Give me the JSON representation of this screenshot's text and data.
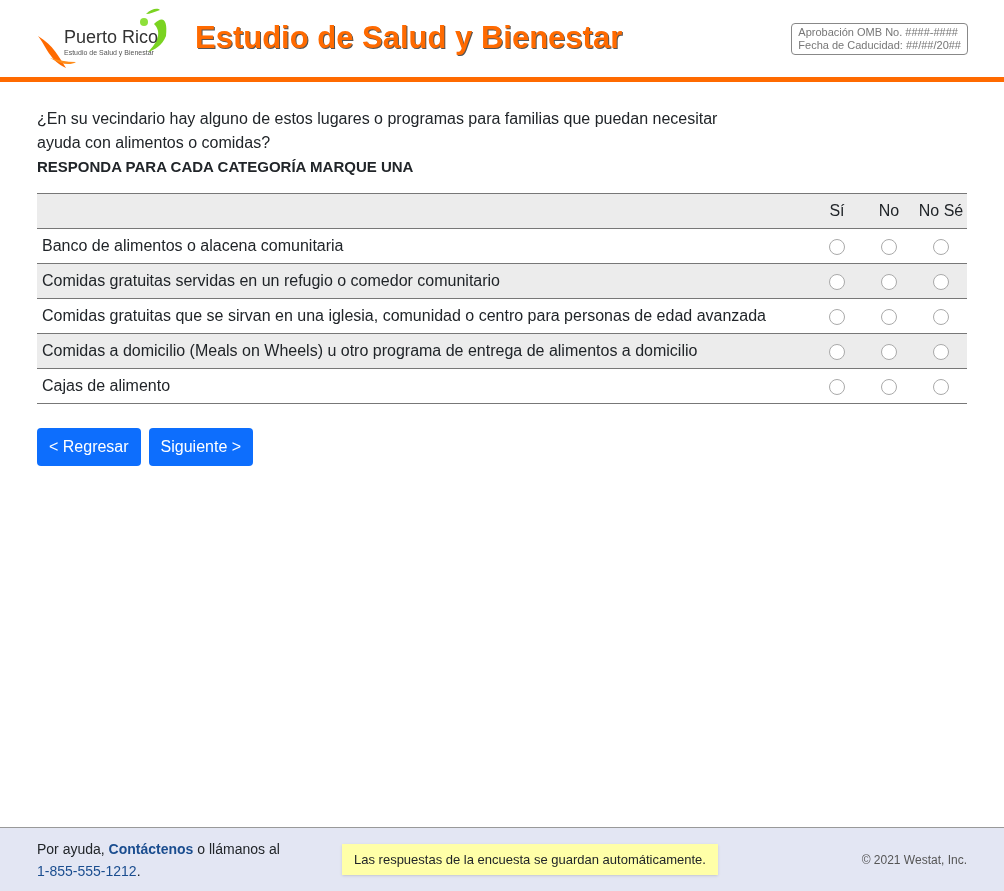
{
  "header": {
    "logo_name": "Puerto Rico",
    "logo_tagline": "Estudio de Salud y Bienestar",
    "title": "Estudio de Salud y Bienestar",
    "omb_lines": [
      "Aprobación OMB No. ####-####",
      "Fecha de Caducidad: ##/##/20##"
    ]
  },
  "question": {
    "text": "¿En su vecindario hay alguno de estos lugares o programas para familias que puedan necesitar ayuda con alimentos o comidas?",
    "instruction": "RESPONDA PARA CADA CATEGORÍA MARQUE UNA"
  },
  "table": {
    "columns": [
      "Sí",
      "No",
      "No Sé"
    ],
    "rows": [
      {
        "label": "Banco de alimentos o alacena comunitaria",
        "options": [
          {
            "selected": false
          },
          {
            "selected": false
          },
          {
            "selected": false
          }
        ]
      },
      {
        "label": "Comidas gratuitas servidas en un refugio o comedor comunitario",
        "options": [
          {
            "selected": false
          },
          {
            "selected": false
          },
          {
            "selected": false
          }
        ]
      },
      {
        "label": "Comidas gratuitas que se sirvan en una iglesia, comunidad o centro para personas de edad avanzada",
        "options": [
          {
            "selected": false
          },
          {
            "selected": false
          },
          {
            "selected": false
          }
        ]
      },
      {
        "label": "Comidas a domicilio (Meals on Wheels) u otro programa de entrega de alimentos a domicilio",
        "options": [
          {
            "selected": false
          },
          {
            "selected": false
          },
          {
            "selected": false
          }
        ]
      },
      {
        "label": "Cajas de alimento",
        "options": [
          {
            "selected": false
          },
          {
            "selected": false
          },
          {
            "selected": false
          }
        ]
      }
    ]
  },
  "buttons": [
    "< Regresar",
    "Siguiente >"
  ],
  "footer": {
    "help_prefix": "Por ayuda,",
    "help_link": "Contáctenos",
    "help_suffix": "o llámanos al",
    "phone": "1-855-555-1212",
    "phone_end": ".",
    "autosave_notice": "Las respuestas de la encuesta se guardan automáticamente.",
    "copyright": "© 2021 Westat, Inc."
  }
}
